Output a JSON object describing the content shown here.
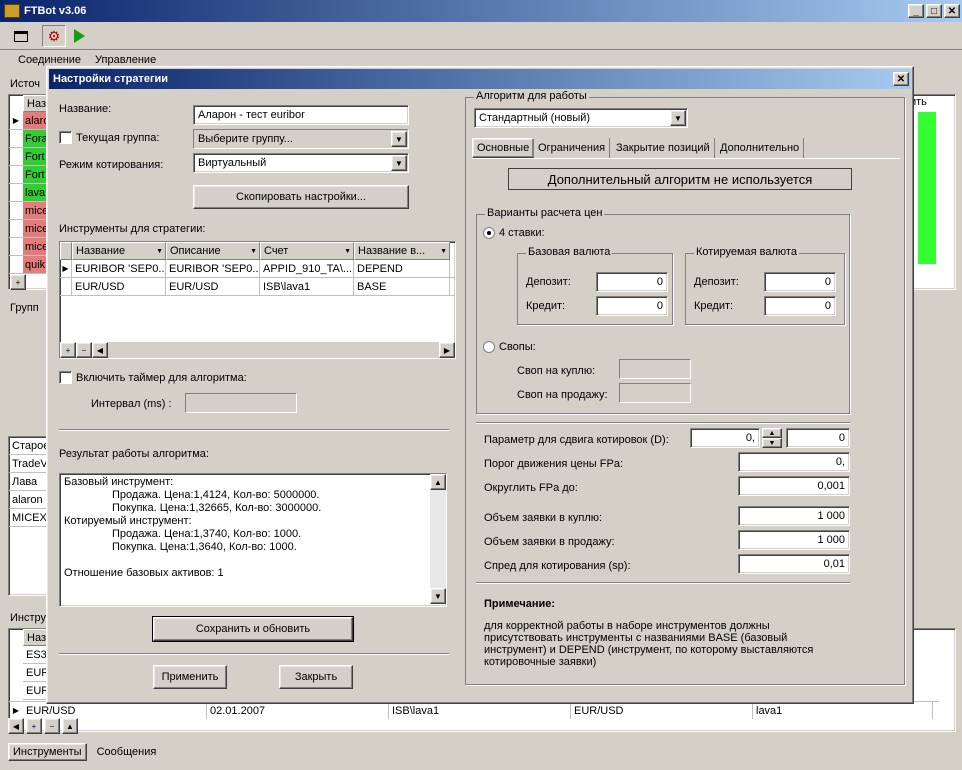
{
  "app": {
    "title": "FTBot v3.06",
    "menu": [
      "Соединение",
      "Управление"
    ],
    "bottom_tabs": [
      "Инструменты",
      "Сообщения"
    ]
  },
  "background": {
    "panel1_label": "Источ",
    "panel1_header": "Назв",
    "panel1_rows": [
      {
        "text": "alaro",
        "color": "#e67b7b"
      },
      {
        "text": "Fora",
        "color": "#33cc33"
      },
      {
        "text": "Fort",
        "color": "#33cc33"
      },
      {
        "text": "Fort",
        "color": "#33cc33"
      },
      {
        "text": "lava",
        "color": "#33cc33"
      },
      {
        "text": "mice",
        "color": "#e67b7b"
      },
      {
        "text": "mice",
        "color": "#e67b7b"
      },
      {
        "text": "mice",
        "color": "#e67b7b"
      },
      {
        "text": "quik",
        "color": "#e67b7b"
      }
    ],
    "right_label": "ить",
    "panel2_label": "Групп",
    "panel2_rows": [
      "Старое",
      "TradeV",
      "Лава",
      "alaron",
      "MICEX"
    ],
    "panel3_label": "Инстру",
    "panel3_header": "Назв",
    "panel3_rows": [
      "ES31",
      "EUR",
      "EUR"
    ],
    "bottom_row": [
      "EUR/USD",
      "02.01.2007",
      "ISB\\lava1",
      "EUR/USD",
      "lava1"
    ]
  },
  "dialog": {
    "title": "Настройки стратегии",
    "name_label": "Название:",
    "name_value": "Аларон - тест euribor",
    "group_label": "Текущая группа:",
    "group_value": "Выберите группу...",
    "mode_label": "Режим котирования:",
    "mode_value": "Виртуальный",
    "copy_button": "Скопировать настройки...",
    "instruments_label": "Инструменты для стратегии:",
    "table_headers": [
      "Название",
      "Описание",
      "Счет",
      "Название в..."
    ],
    "table_rows": [
      [
        "EURIBOR 'SEP0...",
        "EURIBOR 'SEP0...",
        "APPID_910_TA\\...",
        "DEPEND"
      ],
      [
        "EUR/USD",
        "EUR/USD",
        "ISB\\lava1",
        "BASE"
      ]
    ],
    "timer_label": "Включить таймер для алгоритма:",
    "interval_label": "Интервал (ms) :",
    "result_label": "Результат работы алгоритма:",
    "result_lines": [
      "Базовый инструмент:",
      "Продажа. Цена:1,4124, Кол-во: 5000000.",
      "Покупка. Цена:1,32665, Кол-во: 3000000.",
      "Котируемый инструмент:",
      "Продажа. Цена:1,3740, Кол-во: 1000.",
      "Покупка. Цена:1,3640, Кол-во: 1000.",
      "",
      "Отношение базовых активов: 1"
    ],
    "save_button": "Сохранить и обновить",
    "apply_button": "Применить",
    "close_button": "Закрыть",
    "algo_group": "Алгоритм для работы",
    "algo_value": "Стандартный (новый)",
    "tabs": [
      "Основные",
      "Ограничения",
      "Закрытие позиций",
      "Дополнительно"
    ],
    "extra_algo_button": "Дополнительный алгоритм не используется",
    "price_variants": "Варианты расчета цен",
    "four_rates": "4 ставки:",
    "base_currency": "Базовая валюта",
    "quote_currency": "Котируемая валюта",
    "deposit_label": "Депозит:",
    "credit_label": "Кредит:",
    "base_deposit": "0",
    "base_credit": "0",
    "quote_deposit": "0",
    "quote_credit": "0",
    "swaps_label": "Свопы:",
    "swap_buy_label": "Своп на куплю:",
    "swap_sell_label": "Своп на продажу:",
    "shift_param_label": "Параметр для сдвига котировок (D):",
    "shift_value1": "0,",
    "shift_value2": "0",
    "fpa_label": "Порог движения цены FPa:",
    "fpa_value": "0,",
    "round_label": "Округлить FPa до:",
    "round_value": "0,001",
    "buy_volume_label": "Объем заявки в куплю:",
    "buy_volume_value": "1 000",
    "sell_volume_label": "Объем заявки в продажу:",
    "sell_volume_value": "1 000",
    "spread_label": "Спред для котирования (sp):",
    "spread_value": "0,01",
    "note_title": "Примечание:",
    "note_text": "для корректной работы в наборе инструментов должны присутствовать инструменты с названиями BASE (базовый инструмент) и DEPEND (инструмент,  по которому выставляются котировочные заявки)"
  }
}
